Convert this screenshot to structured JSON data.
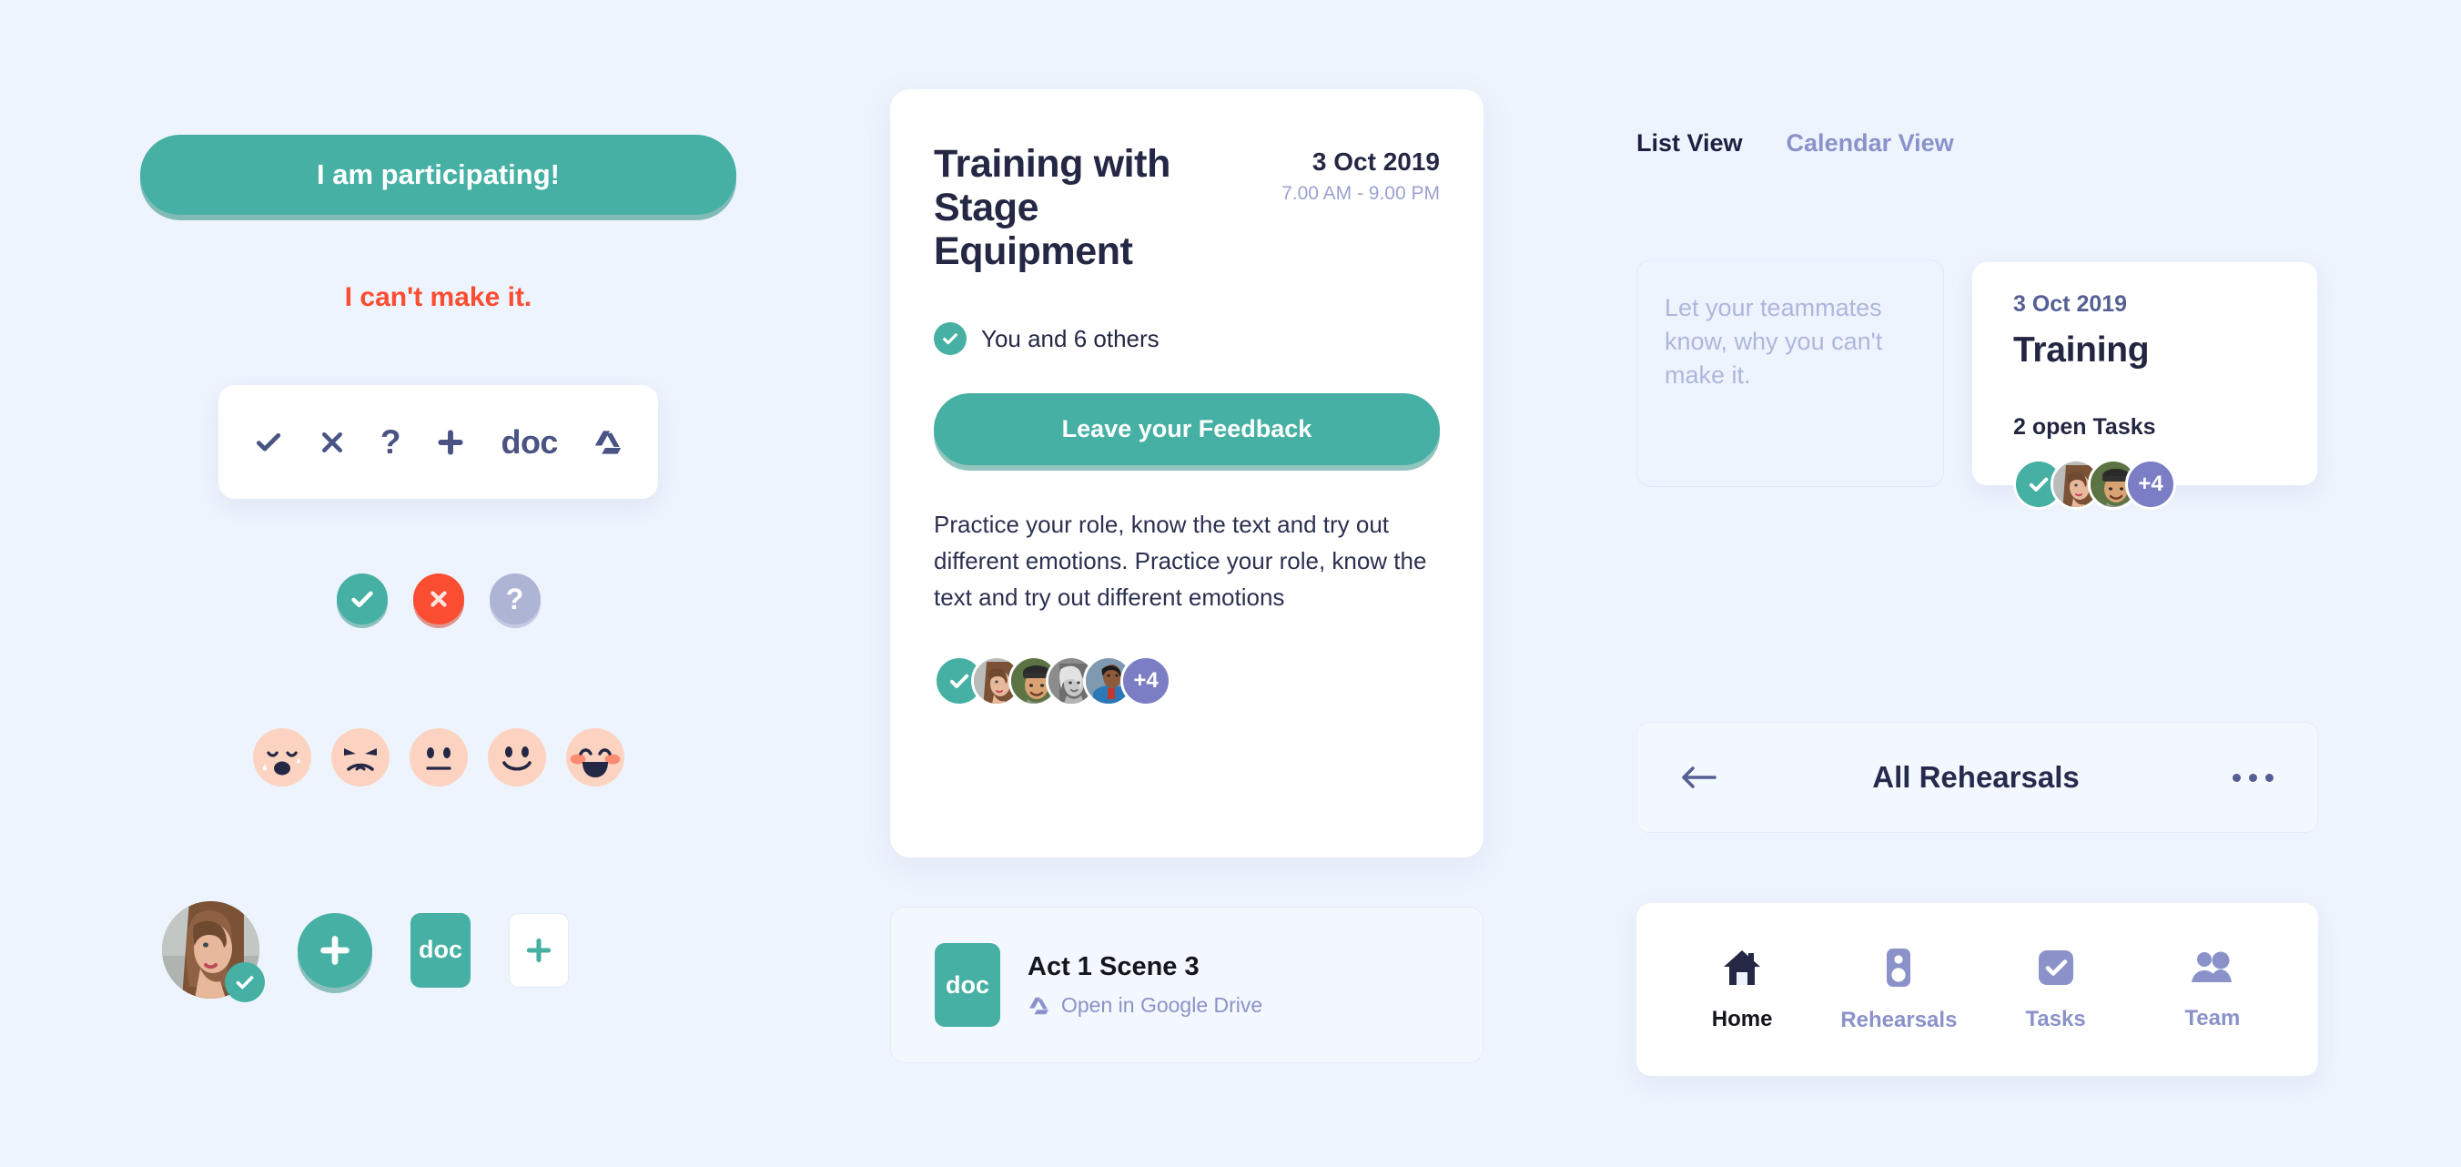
{
  "theme": {
    "background": "#eef4fd",
    "teal": "#45b0a3",
    "red": "#fa4d32",
    "purple": "#7b7ec4",
    "muted_purple": "#8b92c9",
    "periwinkle": "#aeb4d4",
    "dark_navy": "#242844",
    "peach": "#fcd3c1"
  },
  "left": {
    "participating_button": "I am participating!",
    "cant_make_it": "I can't make it.",
    "toolbar": {
      "icons": [
        {
          "name": "check-icon",
          "label": ""
        },
        {
          "name": "close-x-icon",
          "label": ""
        },
        {
          "name": "question-mark-icon",
          "label": "?"
        },
        {
          "name": "plus-icon",
          "label": ""
        },
        {
          "name": "doc-icon",
          "label": "doc"
        },
        {
          "name": "google-drive-icon",
          "label": ""
        }
      ]
    },
    "status_circles": [
      {
        "name": "status-yes",
        "glyph": "check"
      },
      {
        "name": "status-no",
        "glyph": "x"
      },
      {
        "name": "status-maybe",
        "glyph": "?"
      }
    ],
    "emojis": [
      {
        "name": "emoji-crying"
      },
      {
        "name": "emoji-angry"
      },
      {
        "name": "emoji-neutral"
      },
      {
        "name": "emoji-smiling"
      },
      {
        "name": "emoji-laughing"
      }
    ],
    "bottom_row": {
      "doc_tile_label": "doc"
    }
  },
  "center": {
    "title": "Training with Stage Equipment",
    "date": "3 Oct 2019",
    "time": "7.00 AM - 9.00 PM",
    "attendees_label": "You and 6 others",
    "feedback_button": "Leave your Feedback",
    "description": "Practice your role, know the text and try out different emotions. Practice your role, know the text and try out different emotions",
    "avatar_overflow": "+4",
    "attachment": {
      "thumb_label": "doc",
      "name": "Act 1 Scene 3",
      "link": "Open in Google Drive"
    }
  },
  "right": {
    "tabs": [
      {
        "label": "List View",
        "active": true
      },
      {
        "label": "Calendar View",
        "active": false
      }
    ],
    "note_placeholder": "Let your teammates know, why you can't make it.",
    "training_card": {
      "date": "3 Oct 2019",
      "title": "Training",
      "tasks": "2 open Tasks",
      "avatar_overflow": "+4"
    },
    "rehearsals_bar": {
      "title": "All Rehearsals",
      "back_icon": "arrow-left-icon",
      "menu_icon": "more-horizontal-icon"
    },
    "nav": [
      {
        "label": "Home",
        "icon": "home-icon",
        "active": true
      },
      {
        "label": "Rehearsals",
        "icon": "speaker-icon",
        "active": false
      },
      {
        "label": "Tasks",
        "icon": "checkbox-icon",
        "active": false
      },
      {
        "label": "Team",
        "icon": "people-icon",
        "active": false
      }
    ]
  }
}
